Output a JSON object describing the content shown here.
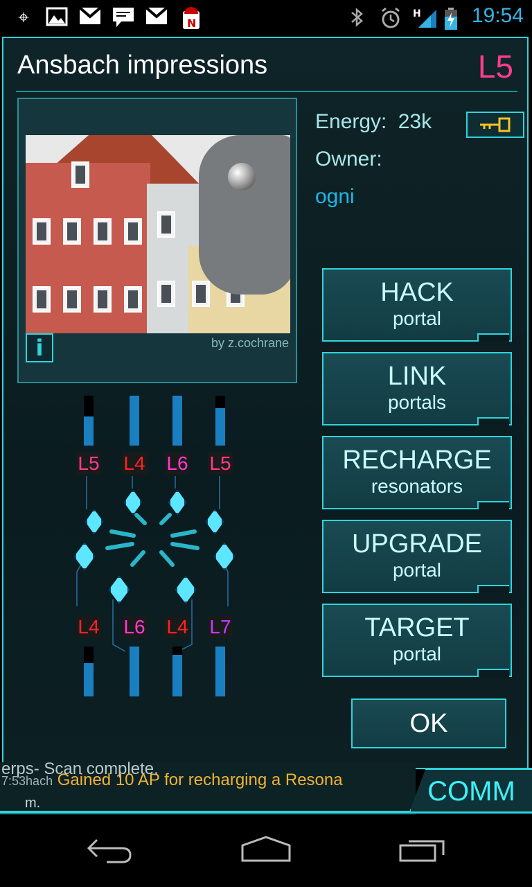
{
  "status_bar": {
    "time": "19:54",
    "notification_icons": [
      "location-icon",
      "image-icon",
      "gmail-icon",
      "chat-icon",
      "gmail-icon",
      "android-n-icon"
    ],
    "right_icons": [
      "bluetooth-icon",
      "alarm-icon",
      "signal-icon",
      "battery-icon"
    ],
    "signal_label": "H"
  },
  "portal": {
    "name": "Ansbach impressions",
    "level": "L5",
    "photo_credit": "by z.cochrane",
    "info_button": "i",
    "energy_label": "Energy:",
    "energy_value": "23k",
    "owner_label": "Owner:",
    "owner_name": "ogni"
  },
  "resonators": {
    "top": [
      {
        "level": "L5",
        "color": "#ff3b8d",
        "fill": 0.58
      },
      {
        "level": "L4",
        "color": "#ff2424",
        "fill": 1.0
      },
      {
        "level": "L6",
        "color": "#ff3bd0",
        "fill": 1.0
      },
      {
        "level": "L5",
        "color": "#ff3b8d",
        "fill": 0.75
      }
    ],
    "bottom": [
      {
        "level": "L4",
        "color": "#ff2424",
        "fill": 0.67
      },
      {
        "level": "L6",
        "color": "#ff3bd0",
        "fill": 1.0
      },
      {
        "level": "L4",
        "color": "#ff2424",
        "fill": 0.83
      },
      {
        "level": "L7",
        "color": "#c23bff",
        "fill": 1.0
      }
    ]
  },
  "actions": [
    {
      "main": "HACK",
      "sub": "portal"
    },
    {
      "main": "LINK",
      "sub": "portals"
    },
    {
      "main": "RECHARGE",
      "sub": "resonators"
    },
    {
      "main": "UPGRADE",
      "sub": "portal"
    },
    {
      "main": "TARGET",
      "sub": "portal"
    }
  ],
  "ok_label": "OK",
  "ticker": {
    "line1": "erps- Scan complete.",
    "line2_time": "7:53",
    "line2_place": "hach",
    "line2_msg": " Gained 10 AP for recharging a Resona",
    "line3": "m."
  },
  "comm_label": "COMM",
  "colors": {
    "accent": "#2fd4dc",
    "owner": "#20b6e6",
    "portal_level": "#ff3b8d",
    "key": "#f7c325"
  }
}
